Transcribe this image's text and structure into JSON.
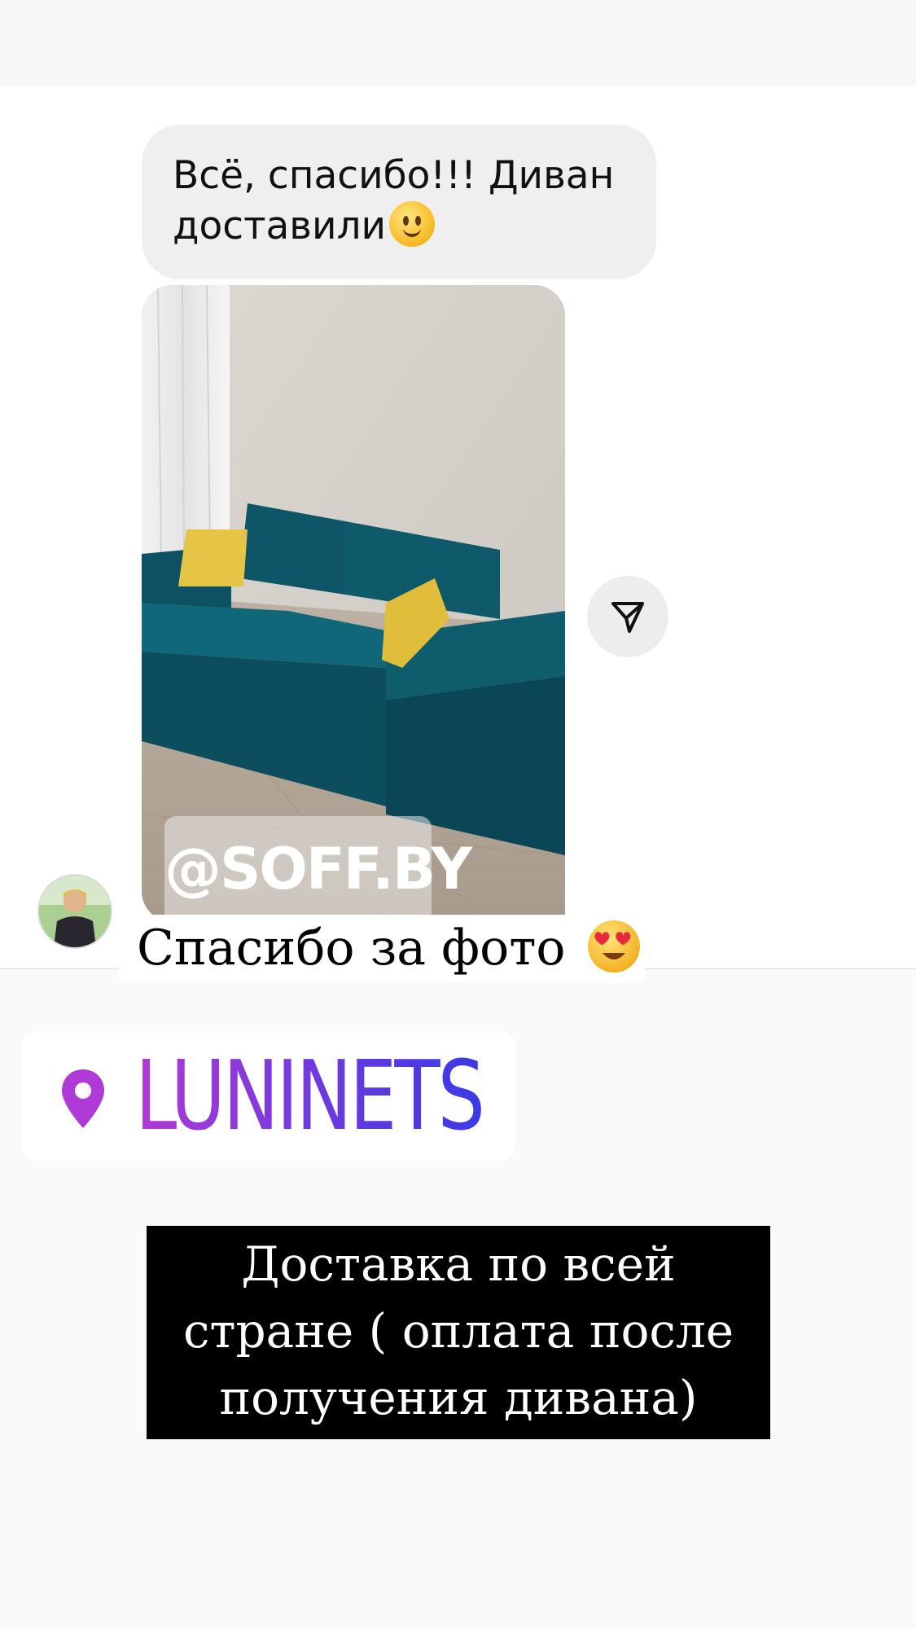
{
  "message": {
    "text": "Всё, спасибо!!!  Диван доставили",
    "emoji": "slightly-smiling-face"
  },
  "photo": {
    "watermark": "@SOFF.BY",
    "colors": {
      "sofa": "#0f5a6a",
      "pillow": "#e6c445",
      "wall": "#d6d2cc",
      "floor": "#b6a898"
    }
  },
  "share_button": {
    "icon": "paper-plane-icon"
  },
  "avatar": {
    "alt": "user-avatar"
  },
  "caption": {
    "text": "Спасибо за фото",
    "emoji": "heart-eyes-emoji"
  },
  "location": {
    "label": "LUNINETS",
    "icon": "location-pin-icon",
    "color_start": "#b03ad7",
    "color_end": "#3a3ae6"
  },
  "promo": {
    "lines": [
      "Доставка по всей",
      "стране ( оплата после",
      "получения дивана)"
    ]
  }
}
